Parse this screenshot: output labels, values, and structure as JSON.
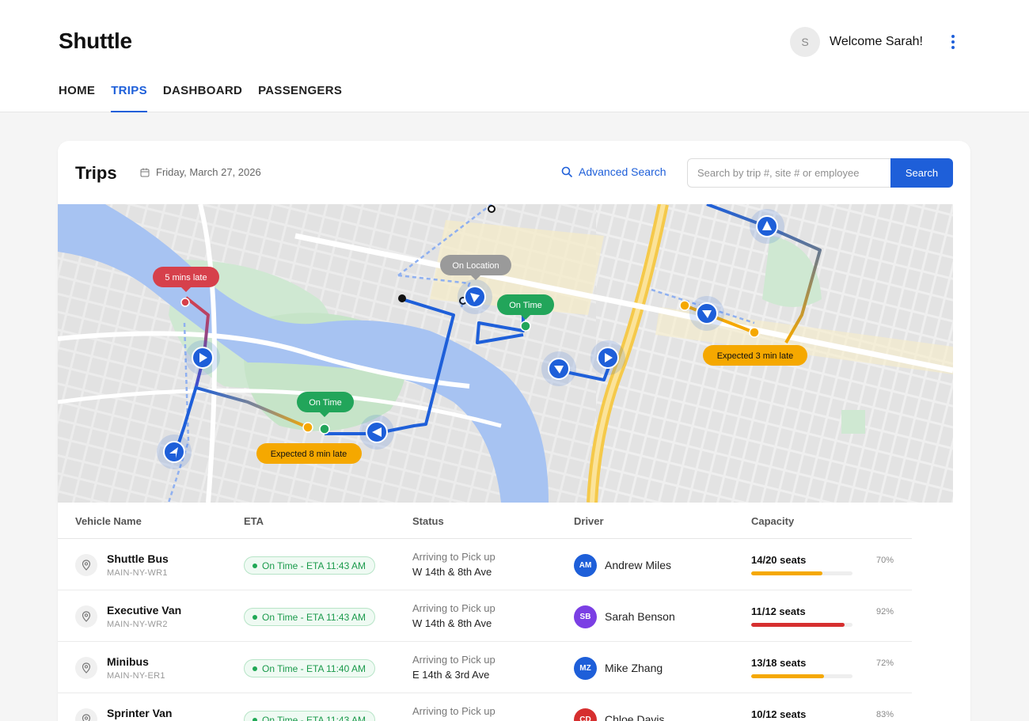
{
  "app": {
    "title": "Shuttle"
  },
  "user": {
    "initial": "S",
    "welcome": "Welcome Sarah!"
  },
  "nav": {
    "items": [
      "HOME",
      "TRIPS",
      "DASHBOARD",
      "PASSENGERS"
    ],
    "active": "TRIPS"
  },
  "trips": {
    "title": "Trips",
    "date": "Friday, March 27, 2026",
    "advanced_search": "Advanced Search",
    "search_placeholder": "Search by trip #, site # or employee",
    "search_button": "Search"
  },
  "map": {
    "labels": {
      "late_red": "5 mins late",
      "on_location": "On Location",
      "on_time_1": "On Time",
      "on_time_2": "On Time",
      "expected_8": "Expected 8 min late",
      "expected_3": "Expected 3 min late"
    },
    "colors": {
      "route": "#1e5fd9",
      "late": "#d6404b",
      "warning": "#f5a800",
      "ok": "#22a55a",
      "neutral": "#8c8c8c"
    }
  },
  "table": {
    "headers": [
      "Vehicle Name",
      "ETA",
      "Status",
      "Driver",
      "Capacity"
    ],
    "rows": [
      {
        "name": "Shuttle Bus",
        "code": "MAIN-NY-WR1",
        "eta": "On Time - ETA 11:43 AM",
        "status_line1": "Arriving to Pick up",
        "status_line2": "W 14th & 8th Ave",
        "driver_initials": "AM",
        "driver_name": "Andrew Miles",
        "driver_color": "#1e5fd9",
        "seats": "14/20 seats",
        "percent": "70%",
        "fill": 0.7,
        "bar_color": "#f5a800"
      },
      {
        "name": "Executive Van",
        "code": "MAIN-NY-WR2",
        "eta": "On Time - ETA 11:43 AM",
        "status_line1": "Arriving to Pick up",
        "status_line2": "W 14th & 8th Ave",
        "driver_initials": "SB",
        "driver_name": "Sarah Benson",
        "driver_color": "#7b3fe4",
        "seats": "11/12 seats",
        "percent": "92%",
        "fill": 0.92,
        "bar_color": "#d62f2f"
      },
      {
        "name": "Minibus",
        "code": "MAIN-NY-ER1",
        "eta": "On Time - ETA 11:40 AM",
        "status_line1": "Arriving to Pick up",
        "status_line2": "E 14th & 3rd Ave",
        "driver_initials": "MZ",
        "driver_name": "Mike Zhang",
        "driver_color": "#1e5fd9",
        "seats": "13/18 seats",
        "percent": "72%",
        "fill": 0.72,
        "bar_color": "#f5a800"
      },
      {
        "name": "Sprinter Van",
        "code": "",
        "eta": "On Time - ETA 11:43 AM",
        "status_line1": "Arriving to Pick up",
        "status_line2": "",
        "driver_initials": "CD",
        "driver_name": "Chloe Davis",
        "driver_color": "#d62f2f",
        "seats": "10/12 seats",
        "percent": "83%",
        "fill": 0.83,
        "bar_color": "#f5a800"
      }
    ]
  }
}
